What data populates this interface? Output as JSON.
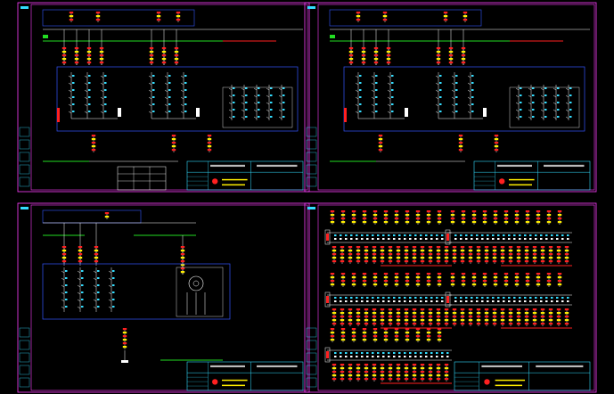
{
  "viewer": {
    "colors": {
      "background": "#000000",
      "frame": "#ff3fff",
      "wire": "#ffffff",
      "bus_green": "#22dd22",
      "bus_red": "#ff2020",
      "device_yellow": "#ffee00",
      "panel_blue": "#3355ff",
      "contact_cyan": "#33ddff",
      "titleblock": "#33ddff",
      "logo_red": "#ff2020"
    }
  },
  "sheets": [
    {
      "id": "sheet-1",
      "title": "",
      "drawing_no": ""
    },
    {
      "id": "sheet-2",
      "title": "",
      "drawing_no": ""
    },
    {
      "id": "sheet-3",
      "title": "",
      "drawing_no": ""
    },
    {
      "id": "sheet-4",
      "title": "",
      "drawing_no": ""
    }
  ]
}
